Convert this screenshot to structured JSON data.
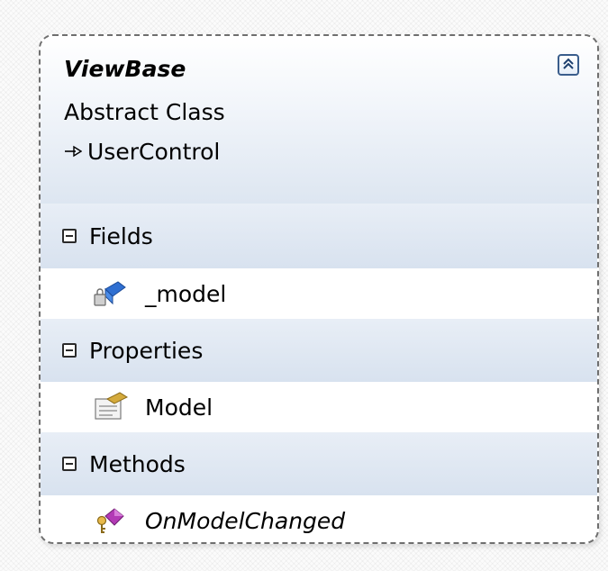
{
  "class_shape": {
    "name": "ViewBase",
    "kind": "Abstract Class",
    "base_type": "UserControl",
    "base_arrow_icon": "inheritance-arrow-icon",
    "collapse_icon": "double-chevron-up-icon"
  },
  "sections": [
    {
      "label": "Fields",
      "toggle_icon": "collapse-minus-icon",
      "members": [
        {
          "label": "_model",
          "icon": "private-field-icon",
          "italic": false
        }
      ]
    },
    {
      "label": "Properties",
      "toggle_icon": "collapse-minus-icon",
      "members": [
        {
          "label": "Model",
          "icon": "property-icon",
          "italic": false
        }
      ]
    },
    {
      "label": "Methods",
      "toggle_icon": "collapse-minus-icon",
      "members": [
        {
          "label": "OnModelChanged",
          "icon": "protected-method-icon",
          "italic": true
        }
      ]
    }
  ],
  "colors": {
    "header_gradient_end": "#dde6f1",
    "section_band": "#d8e2ef",
    "border": "#6f6f6f"
  }
}
